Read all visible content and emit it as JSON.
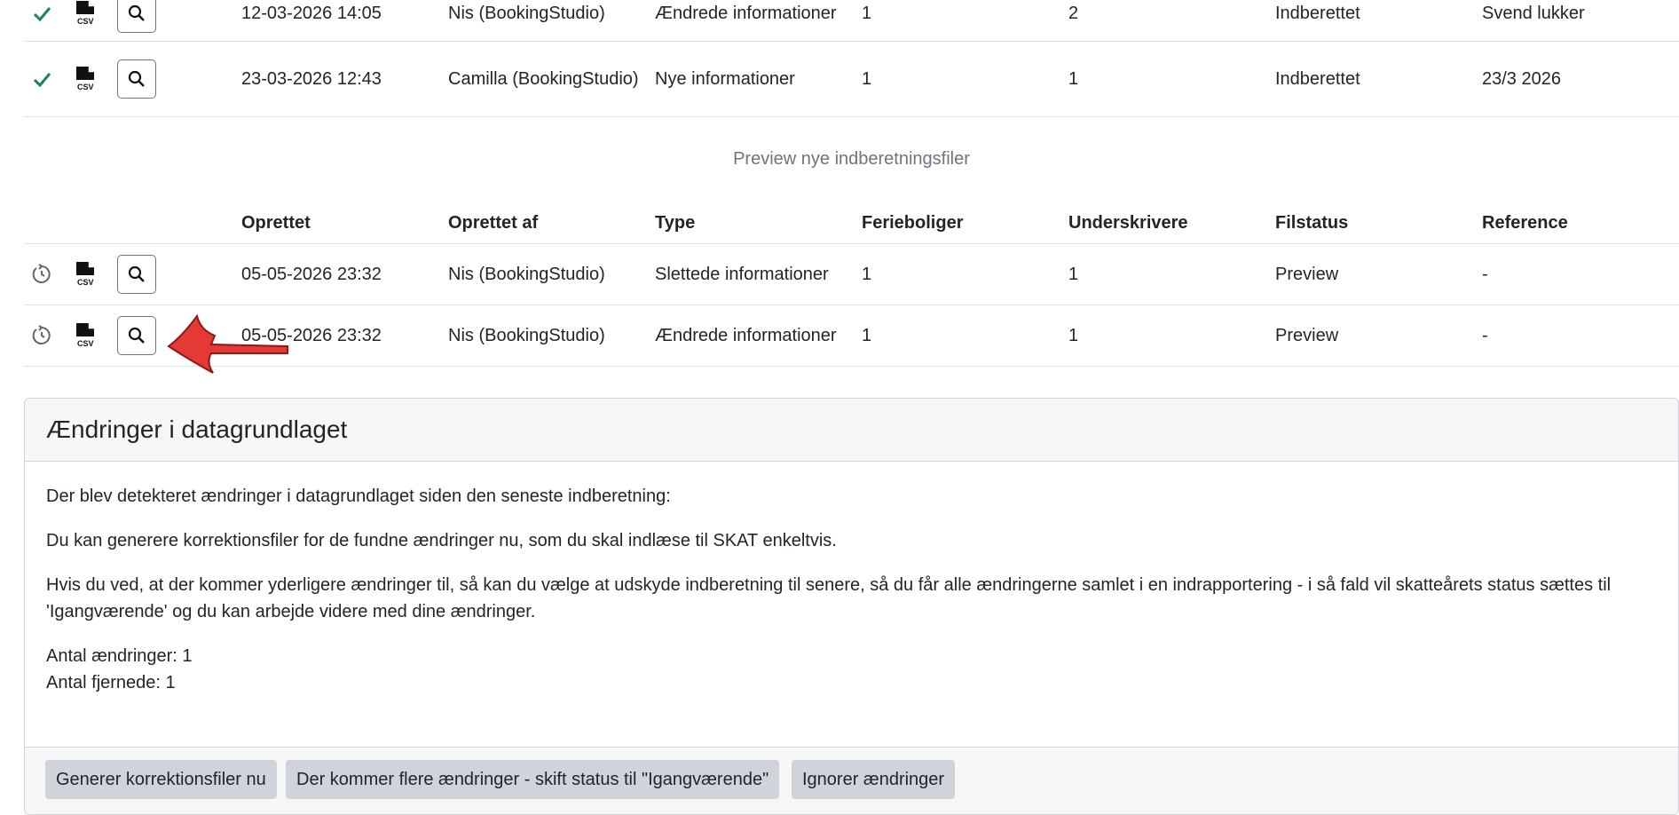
{
  "top_rows": [
    {
      "status_icon": "check-icon",
      "created": "12-03-2026 14:05",
      "created_by": "Nis (BookingStudio)",
      "type": "Ændrede informationer",
      "ferieboliger": "1",
      "underskrivere": "2",
      "filstatus": "Indberettet",
      "reference": "Svend lukker"
    },
    {
      "status_icon": "check-icon",
      "created": "23-03-2026 12:43",
      "created_by": "Camilla (BookingStudio)",
      "type": "Nye informationer",
      "ferieboliger": "1",
      "underskrivere": "1",
      "filstatus": "Indberettet",
      "reference": "23/3 2026"
    }
  ],
  "preview_section": {
    "title": "Preview nye indberetningsfiler",
    "headers": {
      "created": "Oprettet",
      "created_by": "Oprettet af",
      "type": "Type",
      "ferieboliger": "Ferieboliger",
      "underskrivere": "Underskrivere",
      "filstatus": "Filstatus",
      "reference": "Reference"
    },
    "rows": [
      {
        "status_icon": "pending-clock-icon",
        "created": "05-05-2026 23:32",
        "created_by": "Nis (BookingStudio)",
        "type": "Slettede informationer",
        "ferieboliger": "1",
        "underskrivere": "1",
        "filstatus": "Preview",
        "reference": "-"
      },
      {
        "status_icon": "pending-clock-icon",
        "created": "05-05-2026 23:32",
        "created_by": "Nis (BookingStudio)",
        "type": "Ændrede informationer",
        "ferieboliger": "1",
        "underskrivere": "1",
        "filstatus": "Preview",
        "reference": "-"
      }
    ]
  },
  "card": {
    "title": "Ændringer i datagrundlaget",
    "p1": "Der blev detekteret ændringer i datagrundlaget siden den seneste indberetning:",
    "p2": "Du kan generere korrektionsfiler for de fundne ændringer nu, som du skal indlæse til SKAT enkeltvis.",
    "p3": "Hvis du ved, at der kommer yderligere ændringer til, så kan du vælge at udskyde indberetning til senere, så du får alle ændringerne samlet i en indrapportering - i så fald vil skatteårets status sættes til 'Igangværende' og du kan arbejde videre med dine ændringer.",
    "count_changes": "Antal ændringer: 1",
    "count_removed": "Antal fjernede: 1",
    "buttons": {
      "generate": "Generer korrektionsfiler nu",
      "postpone": "Der kommer flere ændringer - skift status til \"Igangværende\"",
      "ignore": "Ignorer ændringer"
    }
  },
  "colors": {
    "check": "#198754",
    "annotation_arrow": "#e53935"
  }
}
